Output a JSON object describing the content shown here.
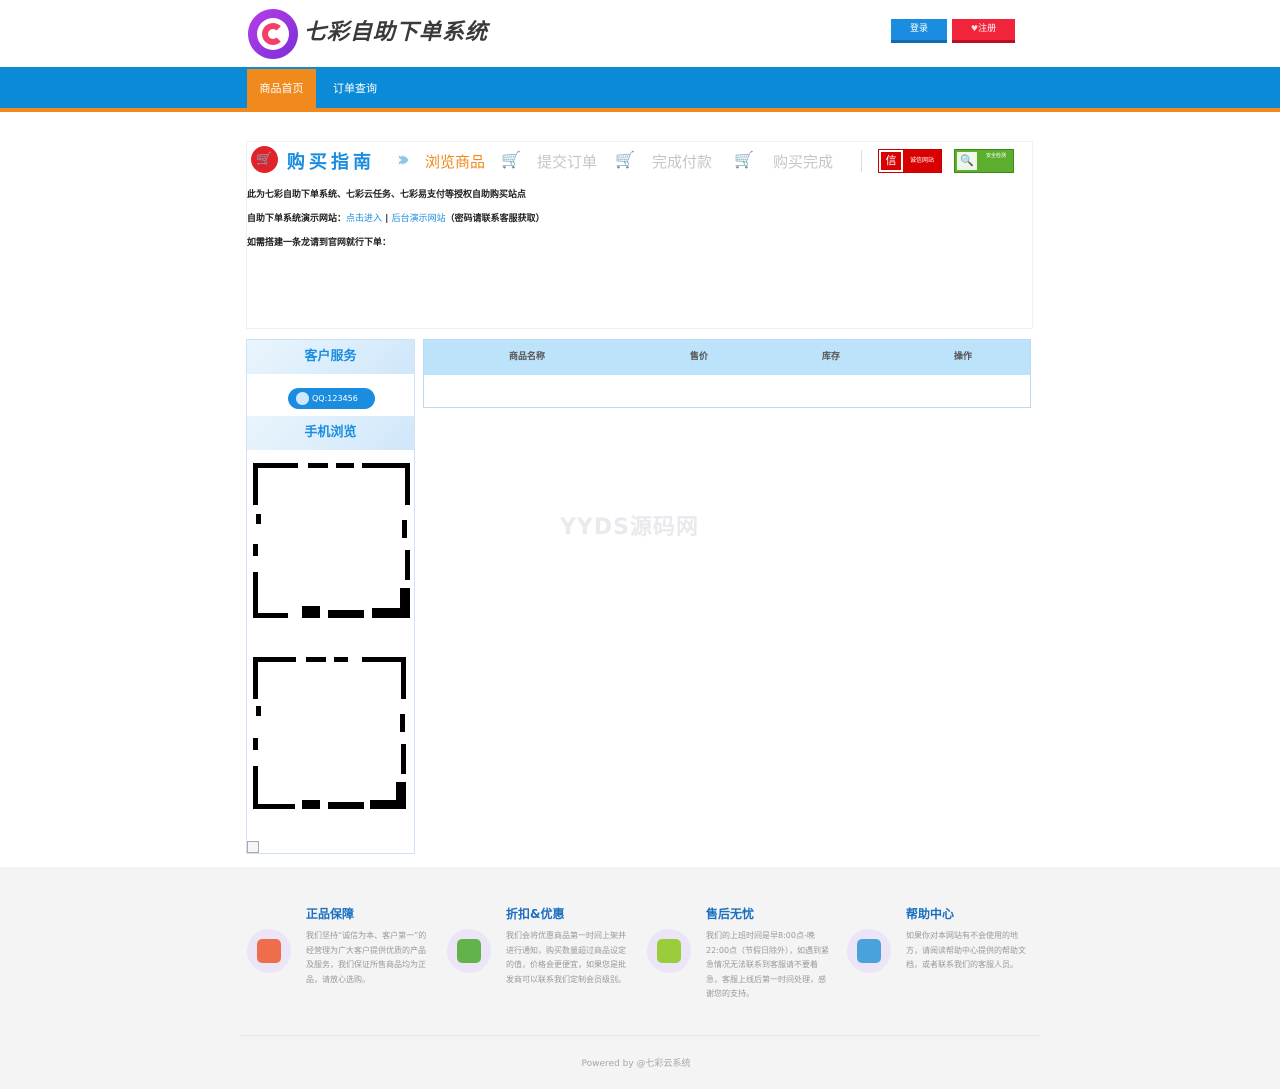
{
  "header": {
    "site_title": "七彩自助下单系统",
    "login_label": "登录",
    "register_label": "注册",
    "register_icon": "heart-icon"
  },
  "nav": {
    "items": [
      {
        "label": "商品首页",
        "active": true
      },
      {
        "label": "订单查询",
        "active": false
      }
    ]
  },
  "guide": {
    "title": "购买指南",
    "steps": [
      "浏览商品",
      "提交订单",
      "完成付款",
      "购买完成"
    ],
    "badge_credit": {
      "glyph": "信",
      "label": "诚信网站"
    },
    "badge_safe": {
      "label": "安全检测"
    },
    "line1": "此为七彩自助下单系统、七彩云任务、七彩易支付等授权自助购买站点",
    "line2_prefix": "自助下单系统演示网站：",
    "line2_link1": "点击进入",
    "line2_sep": "|",
    "line2_link2": "后台演示网站",
    "line2_suffix": "（密码请联系客服获取）",
    "line3": "如需搭建一条龙请到官网就行下单："
  },
  "sidebar": {
    "service_title": "客户服务",
    "qq_label": "QQ:123456",
    "mobile_title": "手机浏览"
  },
  "product_table": {
    "columns": [
      "商品名称",
      "售价",
      "库存",
      "操作"
    ],
    "rows": []
  },
  "watermark": "YYDS源码网",
  "footer": {
    "features": [
      {
        "title": "正品保障",
        "text": "我们坚持“诚信为本、客户第一”的经营理为广大客户提供优质的产品及服务，我们保证所售商品均为正品，请放心选购。",
        "icon": "shield-badge-icon"
      },
      {
        "title": "折扣&优惠",
        "text": "我们会将优惠商品第一时间上架并进行通知，购买数量超过商品设定的值，价格会更便宜，如果您是批发商可以联系我们定制会员级别。",
        "icon": "gift-icon"
      },
      {
        "title": "售后无忧",
        "text": "我们的上班时间是早8:00点-晚22:00点（节假日除外），如遇到紧急情况无法联系到客服请不要着急，客服上线后第一时间处理，感谢您的支持。",
        "icon": "support-agent-icon"
      },
      {
        "title": "帮助中心",
        "text": "如果你对本网站有不会使用的地方，请阅读帮助中心提供的帮助文档，或者联系我们的客服人员。",
        "icon": "chat-bubble-icon"
      }
    ],
    "copyright": "Powered by @七彩云系统"
  },
  "colors": {
    "brand_blue": "#0b8ad8",
    "accent_orange": "#f08a1c",
    "register_red": "#f0243a"
  }
}
